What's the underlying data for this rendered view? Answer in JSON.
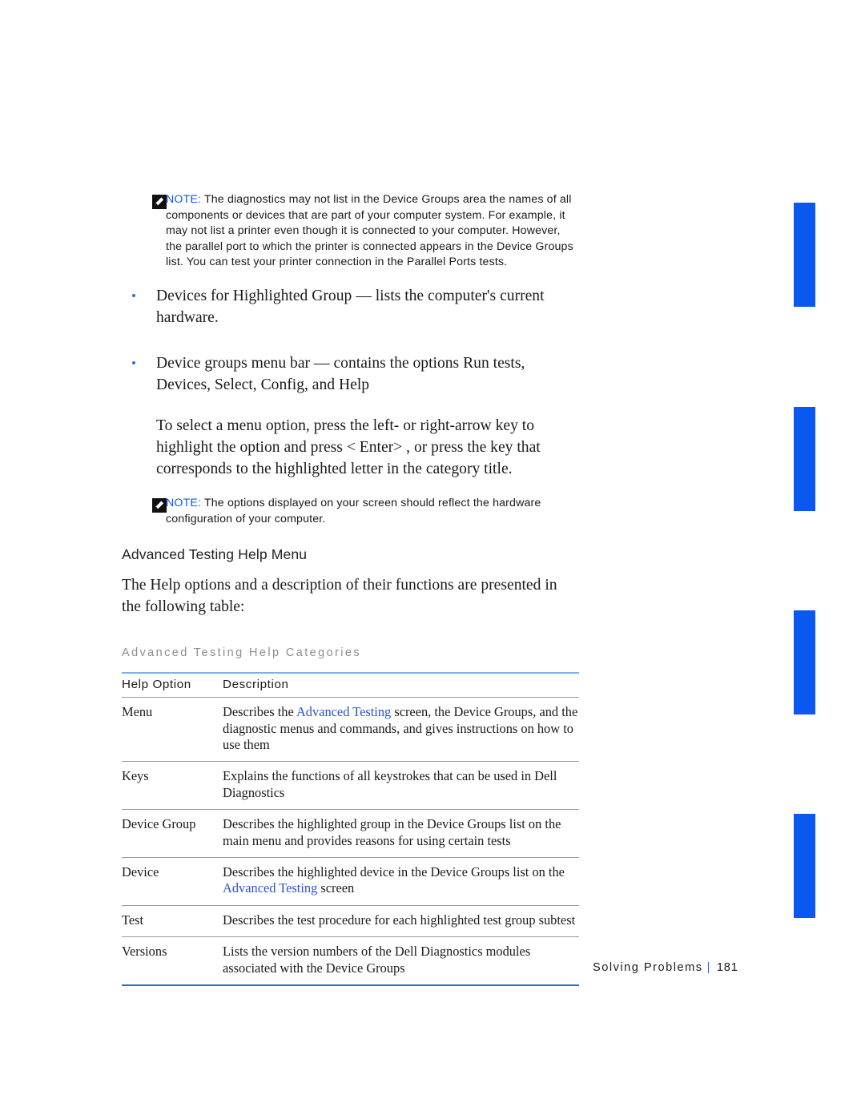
{
  "page": {
    "footer_section": "Solving Problems",
    "footer_separator": "|",
    "footer_page_number": "181",
    "accent_blue": "#0a57f2",
    "link_blue": "#2a52d6",
    "note_label_blue": "#1356ec",
    "caption_gray": "#8d8d8d"
  },
  "notes": [
    {
      "icon": "note-pencil-icon",
      "label": "NOTE:",
      "text": "The diagnostics may not list in the Device Groups area the names of all components or devices that are part of your computer system. For example, it may not list a printer even though it is connected to your computer. However, the parallel port to which the printer is connected appears in the Device Groups list. You can test your printer connection in the Parallel Ports tests."
    },
    {
      "icon": "note-pencil-icon",
      "label": "NOTE:",
      "text": "The options displayed on your screen should reflect the hardware configuration of your computer."
    }
  ],
  "bullets": [
    "Devices for Highlighted Group — lists the computer's current hardware.",
    "Device groups menu bar — contains the options Run tests, Devices, Select, Config, and Help"
  ],
  "indented_paragraph": "To select a menu option, press the left- or right-arrow key to highlight the option and press < Enter> , or press the key that corresponds to the highlighted letter in the category title.",
  "section": {
    "heading": "Advanced Testing Help Menu",
    "intro": "The Help options and a description of their functions are presented in the following table:"
  },
  "table": {
    "caption": "Advanced Testing Help Categories",
    "columns": [
      "Help Option",
      "Description"
    ],
    "rows": [
      {
        "option": "Menu",
        "desc_pre": "Describes the ",
        "desc_link": "Advanced Testing",
        "desc_post": " screen, the Device Groups, and the diagnostic menus and commands, and gives instructions on how to use them"
      },
      {
        "option": "Keys",
        "desc_pre": "Explains the functions of all keystrokes that can be used in Dell Diagnostics",
        "desc_link": "",
        "desc_post": ""
      },
      {
        "option": "Device Group",
        "desc_pre": "Describes the highlighted group in the Device Groups list on the main menu and provides reasons for using certain tests",
        "desc_link": "",
        "desc_post": ""
      },
      {
        "option": "Device",
        "desc_pre": "Describes the highlighted device in the Device Groups list on the ",
        "desc_link": "Advanced Testing",
        "desc_post": " screen"
      },
      {
        "option": "Test",
        "desc_pre": "Describes the test procedure for each highlighted test group subtest",
        "desc_link": "",
        "desc_post": ""
      },
      {
        "option": "Versions",
        "desc_pre": "Lists the version numbers of the Dell Diagnostics modules associated with the Device Groups",
        "desc_link": "",
        "desc_post": ""
      }
    ]
  }
}
